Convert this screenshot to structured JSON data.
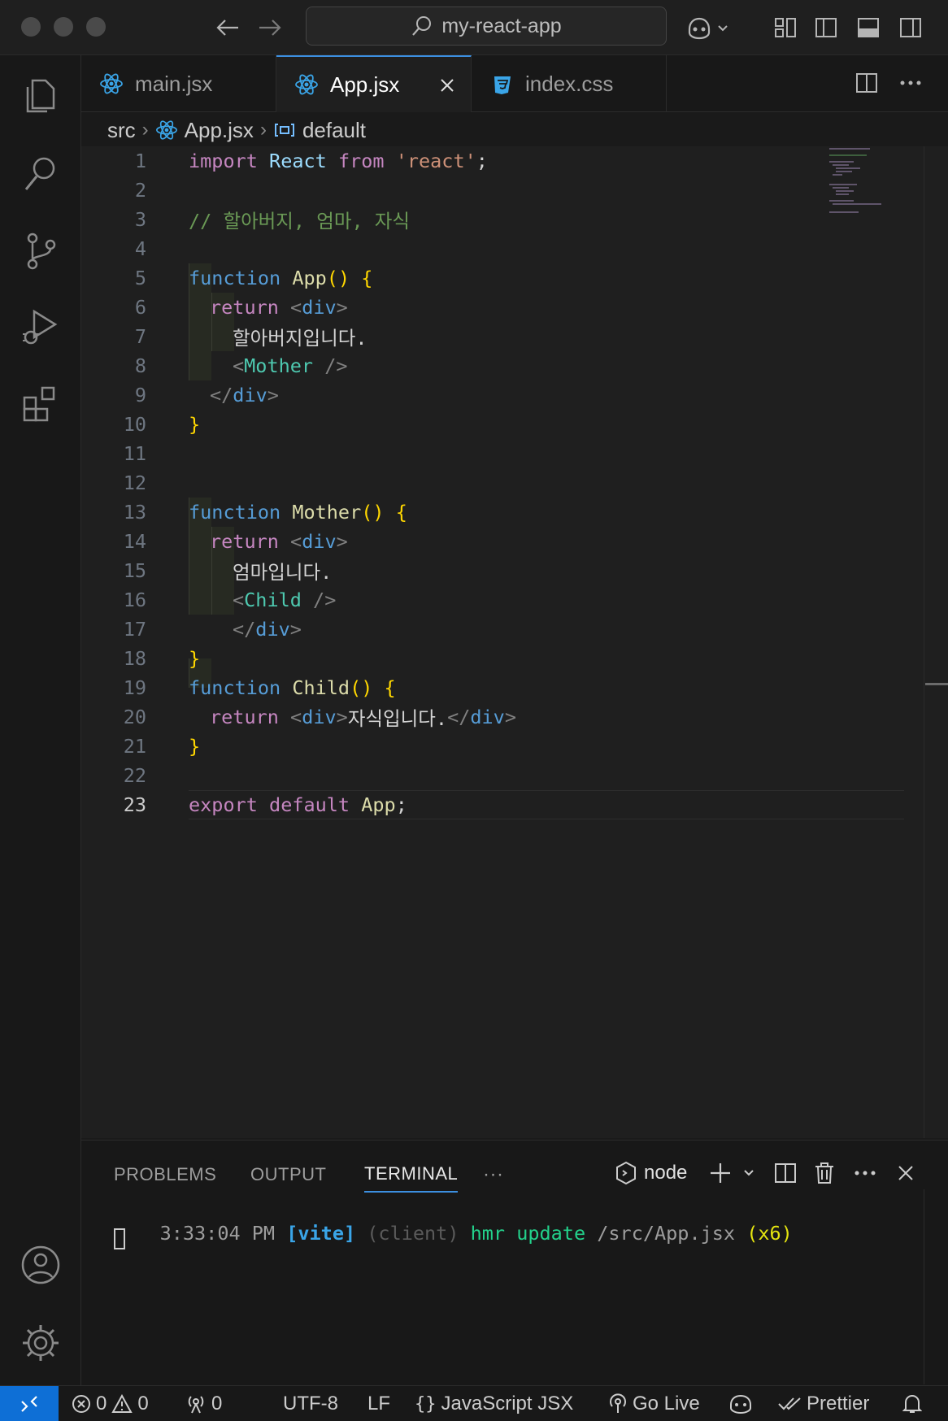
{
  "titlebar": {
    "search_label": "my-react-app"
  },
  "tabs": [
    {
      "label": "main.jsx",
      "icon": "react-icon"
    },
    {
      "label": "App.jsx",
      "icon": "react-icon",
      "active": true
    },
    {
      "label": "index.css",
      "icon": "css-icon"
    }
  ],
  "breadcrumb": {
    "folder": "src",
    "file": "App.jsx",
    "symbol": "default"
  },
  "editor": {
    "current_line": 23,
    "line_numbers": [
      "1",
      "2",
      "3",
      "4",
      "5",
      "6",
      "7",
      "8",
      "9",
      "10",
      "11",
      "12",
      "13",
      "14",
      "15",
      "16",
      "17",
      "18",
      "19",
      "20",
      "21",
      "22",
      "23"
    ],
    "tokens": {
      "l1": [
        "import",
        "React",
        "from",
        "'react'",
        ";"
      ],
      "l3": "// 할아버지, 엄마, 자식",
      "l5": [
        "function",
        "App",
        "()",
        "{"
      ],
      "l6": [
        "return",
        "<",
        "div",
        ">"
      ],
      "l7": "할아버지입니다.",
      "l8": [
        "<",
        "Mother",
        " />"
      ],
      "l9": [
        "</",
        "div",
        ">"
      ],
      "l10": "}",
      "l13": [
        "function",
        "Mother",
        "()",
        "{"
      ],
      "l14": [
        "return",
        "<",
        "div",
        ">"
      ],
      "l15": "엄마입니다.",
      "l16": [
        "<",
        "Child",
        " />"
      ],
      "l17": [
        "</",
        "div",
        ">"
      ],
      "l18": "}",
      "l19": [
        "function",
        "Child",
        "()",
        "{"
      ],
      "l20": [
        "return",
        "<",
        "div",
        ">",
        "자식입니다.",
        "</",
        "div",
        ">"
      ],
      "l21": "}",
      "l23": [
        "export",
        "default",
        "App",
        ";"
      ]
    }
  },
  "panel": {
    "tabs": [
      "PROBLEMS",
      "OUTPUT",
      "TERMINAL"
    ],
    "active_tab": "TERMINAL",
    "more": "···",
    "terminal_profile": "node",
    "terminal_line": {
      "time": "3:33:04 PM",
      "vite": "[vite]",
      "client": "(client)",
      "hmr": "hmr update",
      "path": "/src/App.jsx",
      "count": "(x6)"
    }
  },
  "statusbar": {
    "errors": "0",
    "warnings": "0",
    "ports": "0",
    "encoding": "UTF-8",
    "eol": "LF",
    "language": "JavaScript JSX",
    "golive": "Go Live",
    "prettier": "Prettier"
  },
  "colors": {
    "accent": "#3c8fe0",
    "remote_bg": "#0e6fd6",
    "editor_bg": "#1f1f1f"
  }
}
